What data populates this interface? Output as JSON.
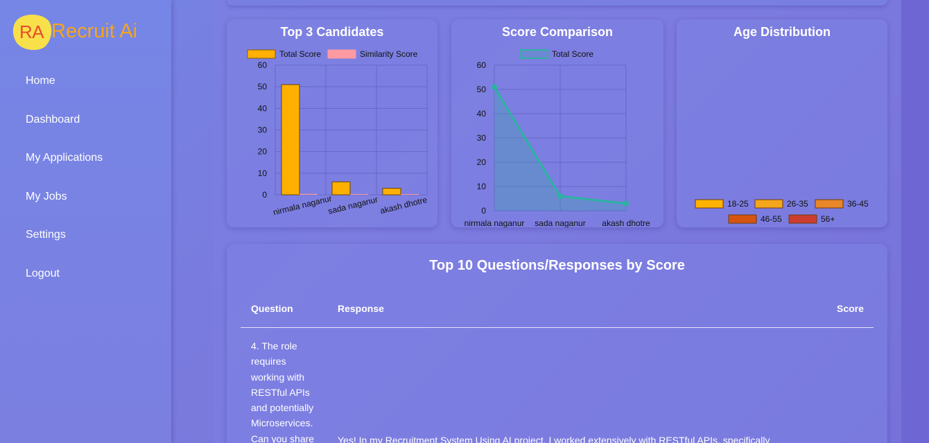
{
  "app": {
    "logo_ra": "RA",
    "logo_text": "Recruit Ai"
  },
  "sidebar": {
    "items": [
      {
        "label": "Home"
      },
      {
        "label": "Dashboard"
      },
      {
        "label": "My Applications"
      },
      {
        "label": "My Jobs"
      },
      {
        "label": "Settings"
      },
      {
        "label": "Logout"
      }
    ]
  },
  "cards": {
    "top3_title": "Top 3 Candidates",
    "score_title": "Score Comparison",
    "age_title": "Age Distribution"
  },
  "colors": {
    "total_score": "#ffb000",
    "similarity_score": "#ff9aa2",
    "line": "#2bb3a0",
    "age_18_25": "#ffb300",
    "age_26_35": "#f4a61c",
    "age_36_45": "#e8862a",
    "age_46_55": "#d65410",
    "age_56_plus": "#cc3d2e"
  },
  "chart_data": [
    {
      "type": "bar",
      "title": "Top 3 Candidates",
      "categories": [
        "nirmala naganur",
        "sada naganur",
        "akash dhotre"
      ],
      "series": [
        {
          "name": "Total Score",
          "values": [
            51,
            6,
            3
          ]
        },
        {
          "name": "Similarity Score",
          "values": [
            0.4,
            0.3,
            0.3
          ]
        }
      ],
      "ylim": [
        0,
        60
      ],
      "yticks": [
        0,
        10,
        20,
        30,
        40,
        50,
        60
      ],
      "legend": "top",
      "grid": true
    },
    {
      "type": "area",
      "title": "Score Comparison",
      "categories": [
        "nirmala naganur",
        "sada naganur",
        "akash dhotre"
      ],
      "series": [
        {
          "name": "Total Score",
          "values": [
            51,
            6,
            3
          ]
        }
      ],
      "ylim": [
        0,
        60
      ],
      "yticks": [
        0,
        10,
        20,
        30,
        40,
        50,
        60
      ],
      "legend": "top",
      "grid": true
    },
    {
      "type": "pie",
      "title": "Age Distribution",
      "categories": [
        "18-25",
        "26-35",
        "36-45",
        "46-55",
        "56+"
      ],
      "values": [
        0,
        0,
        0,
        0,
        0
      ],
      "legend": "bottom"
    }
  ],
  "table": {
    "title": "Top 10 Questions/Responses by Score",
    "headers": {
      "question": "Question",
      "response": "Response",
      "score": "Score"
    },
    "rows": [
      {
        "question": "4. The role requires working with RESTful APIs and potentially Microservices. Can you share",
        "response": "Yes! In my Recruitment System Using AI project, I worked extensively with RESTful APIs, specifically"
      }
    ]
  }
}
